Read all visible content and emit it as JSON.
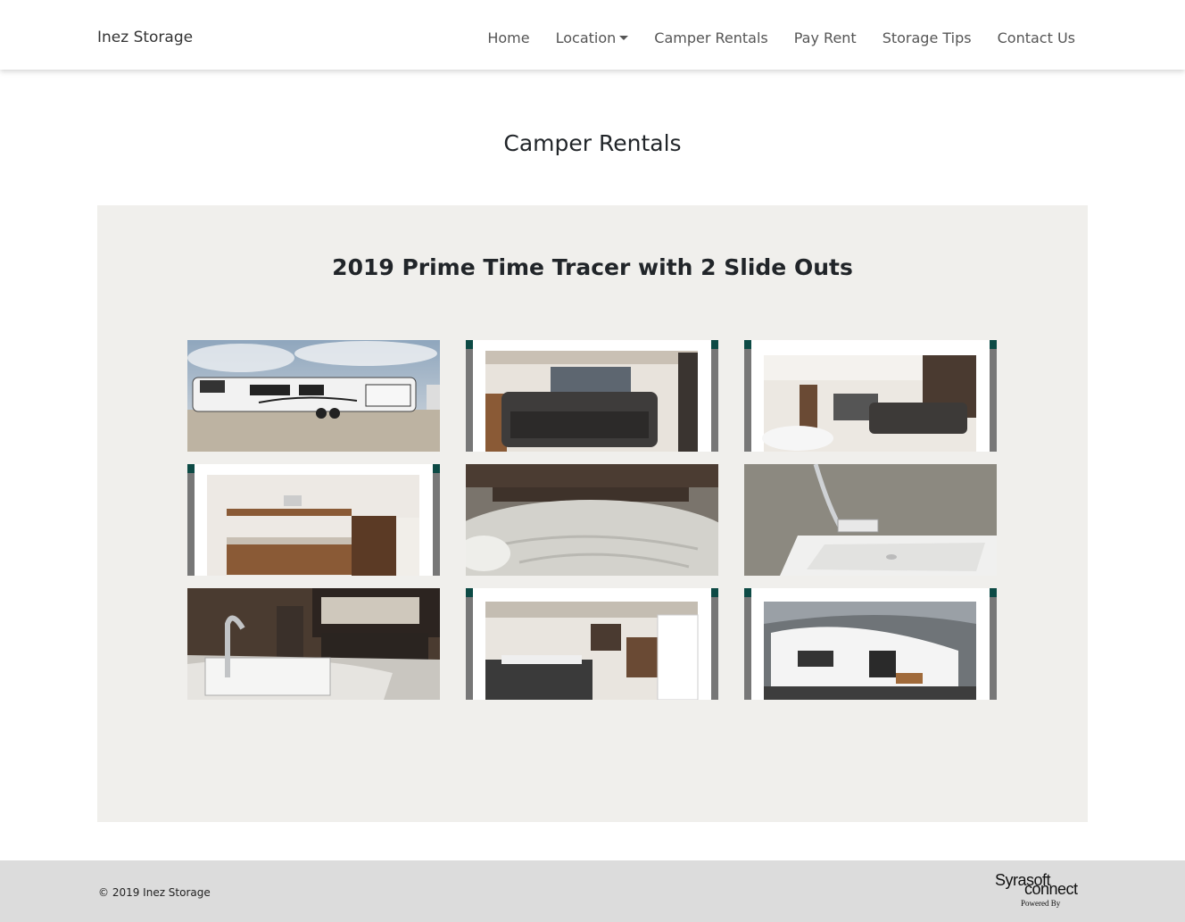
{
  "nav": {
    "brand": "Inez Storage",
    "items": [
      {
        "label": "Home"
      },
      {
        "label": "Location"
      },
      {
        "label": "Camper Rentals"
      },
      {
        "label": "Pay Rent"
      },
      {
        "label": "Storage Tips"
      },
      {
        "label": "Contact Us"
      }
    ]
  },
  "page": {
    "title": "Camper Rentals"
  },
  "gallery": {
    "heading": "2019 Prime Time Tracer with 2 Slide Outs",
    "photos": [
      {
        "subject": "exterior-trailer"
      },
      {
        "subject": "sofa-living-area"
      },
      {
        "subject": "living-kitchen-area"
      },
      {
        "subject": "bunk-beds"
      },
      {
        "subject": "bedroom"
      },
      {
        "subject": "bathroom-tub"
      },
      {
        "subject": "kitchen-sink"
      },
      {
        "subject": "dinette-interior"
      },
      {
        "subject": "exterior-awning"
      }
    ]
  },
  "footer": {
    "copyright": "© 2019 Inez Storage",
    "logo_top": "Syrasoft",
    "logo_bottom": "connect",
    "logo_caption": "Powered By"
  },
  "colors": {
    "panel_bg": "#f0efec",
    "footer_bg": "#dcdcdc",
    "frame_teal": "#0d4a45"
  }
}
